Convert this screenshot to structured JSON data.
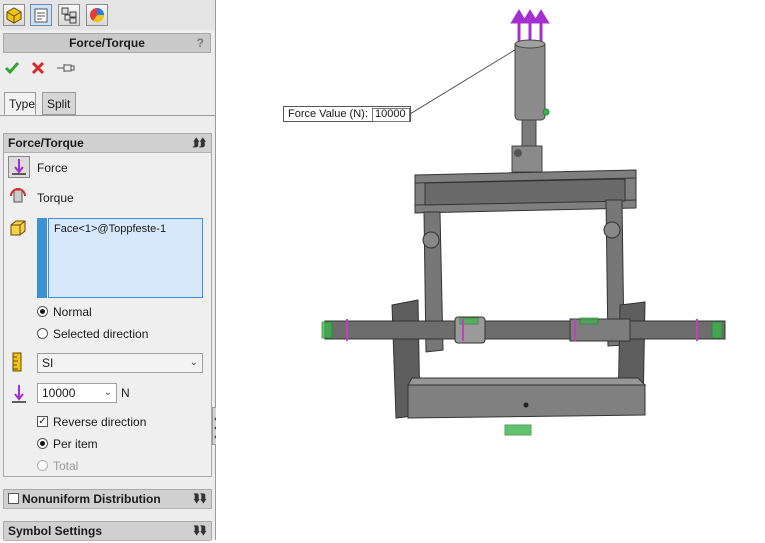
{
  "property_manager": {
    "title": "Force/Torque",
    "help": "?",
    "tabs": [
      "Type",
      "Split"
    ],
    "selected_tab": "Type",
    "force_group": {
      "header": "Force/Torque",
      "force_label": "Force",
      "torque_label": "Torque",
      "selection": "Face<1>@Toppfeste-1",
      "normal_label": "Normal",
      "selected_direction_label": "Selected direction",
      "direction_choice": "Normal",
      "unit_system": "SI",
      "force_value": "10000",
      "unit": "N",
      "reverse_direction_label": "Reverse direction",
      "reverse_direction_checked": true,
      "per_item_label": "Per item",
      "total_label": "Total",
      "distribution_choice": "Per item"
    },
    "nonuniform_label": "Nonuniform Distribution",
    "nonuniform_checked": false,
    "symbol_settings_label": "Symbol Settings"
  },
  "callout": {
    "label": "Force Value (N):",
    "value": "10000"
  },
  "colors": {
    "accent_blue": "#3d8fd6",
    "selection_bg": "#d6e8fa",
    "force_arrow": "#a42fd1",
    "fixture_green": "#3bb44a",
    "ok_green": "#2fa52f",
    "cancel_red": "#d62a2a"
  }
}
